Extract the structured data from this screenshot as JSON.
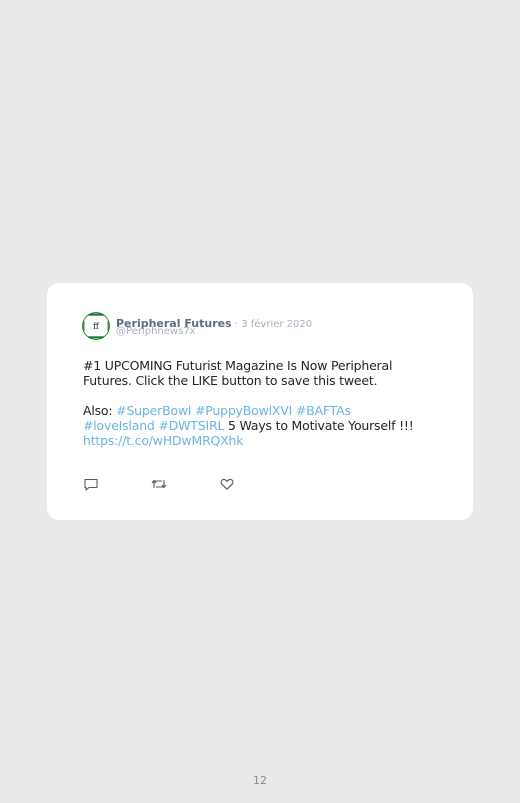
{
  "tweet": {
    "display_name": "Peripheral Futures",
    "separator": " · ",
    "date": "3 février 2020",
    "handle": "@Periphnews7x",
    "avatar_text": "ff",
    "body": {
      "line1": "#1 UPCOMING Futurist Magazine Is Now Peripheral Futures. Click the LIKE button to save this tweet.",
      "also_prefix": "Also: ",
      "hashtags_line": [
        "#SuperBowl",
        "#PuppyBowlXVI",
        "#BAFTAs"
      ],
      "hashtags_line2": [
        "#loveIsland",
        "#DWTSIRL"
      ],
      "tail_text": " 5 Ways to Motivate Yourself !!!",
      "link": "https://t.co/wHDwMRQXhk"
    },
    "actions": {
      "reply_icon": "reply-icon",
      "retweet_icon": "retweet-icon",
      "like_icon": "heart-icon"
    }
  },
  "colors": {
    "background": "#e9e9ea",
    "card": "#ffffff",
    "name": "#5b6d84",
    "meta": "#a6b1bd",
    "link": "#6bb6e0",
    "text": "#1f2326",
    "avatar_green": "#1e7a3a"
  },
  "footer": {
    "page_number": "12"
  }
}
